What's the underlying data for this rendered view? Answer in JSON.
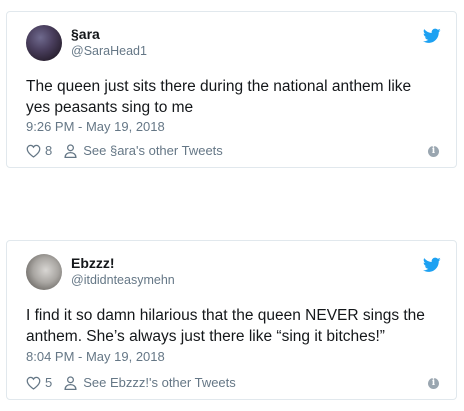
{
  "tweets": [
    {
      "name": "§ara",
      "handle": "@SaraHead1",
      "text": "The queen just sits there during the national anthem like yes peasants sing to me",
      "timestamp": "9:26 PM - May 19, 2018",
      "likes": "8",
      "other_tweets": "See §ara's other Tweets"
    },
    {
      "name": "Ebzzz!",
      "handle": "@itdidnteasymehn",
      "text": "I find it so damn hilarious that the queen NEVER sings the anthem. She’s always just there like “sing it bitches!”",
      "timestamp": "8:04 PM - May 19, 2018",
      "likes": "5",
      "other_tweets": "See Ebzzz!'s other Tweets"
    }
  ],
  "icons": {
    "bird": "twitter-bird-icon",
    "heart": "heart-icon",
    "person": "person-icon",
    "info": "info-icon"
  },
  "colors": {
    "twitter_blue": "#1da1f2",
    "secondary_text": "#657786",
    "border": "#e1e8ed"
  }
}
